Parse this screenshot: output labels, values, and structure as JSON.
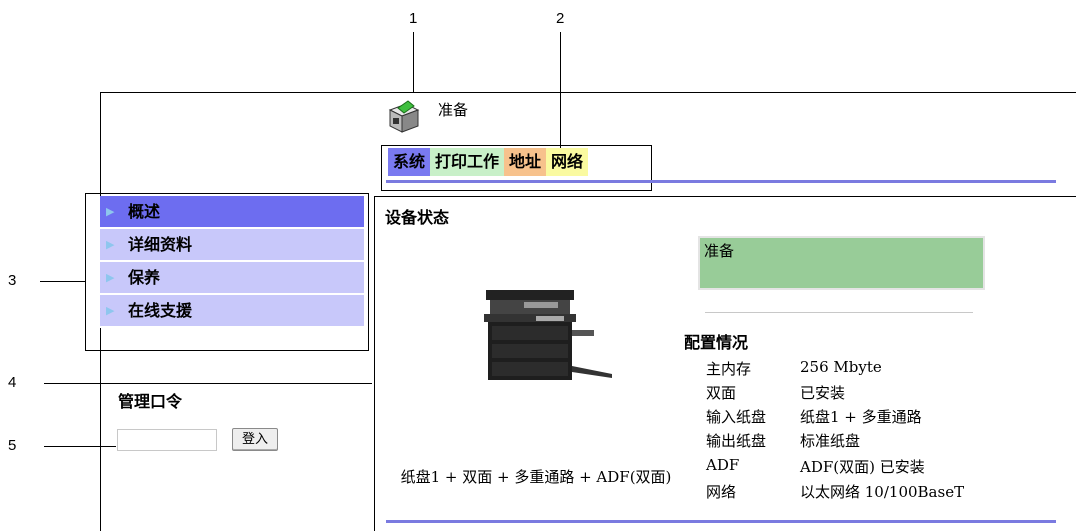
{
  "callouts": {
    "c1": "1",
    "c2": "2",
    "c3": "3",
    "c4": "4",
    "c5": "5"
  },
  "header": {
    "status_text": "准备"
  },
  "tabs": [
    {
      "label": "系统"
    },
    {
      "label": "打印工作"
    },
    {
      "label": "地址"
    },
    {
      "label": "网络"
    }
  ],
  "sidebar": {
    "items": [
      {
        "label": "概述",
        "active": true
      },
      {
        "label": "详细资料"
      },
      {
        "label": "保养"
      },
      {
        "label": "在线支援"
      }
    ],
    "admin": {
      "title": "管理口令",
      "password_value": "",
      "login_label": "登入"
    }
  },
  "main": {
    "heading": "设备状态",
    "status_box_text": "准备",
    "paper_config": "纸盘1 + 双面 + 多重通路 + ADF(双面)",
    "config": {
      "title": "配置情况",
      "rows": [
        {
          "key": "主内存",
          "value": "256 Mbyte"
        },
        {
          "key": "双面",
          "value": "已安装"
        },
        {
          "key": "输入纸盘",
          "value": "纸盘1 + 多重通路"
        },
        {
          "key": "输出纸盘",
          "value": "标准纸盘"
        },
        {
          "key": "ADF",
          "value": "ADF(双面) 已安装"
        },
        {
          "key": "网络",
          "value": "以太网络 10/100BaseT"
        }
      ]
    }
  },
  "colors": {
    "tab_system": "#7a7af0",
    "tab_print": "#c8f0c8",
    "tab_address": "#f7c28c",
    "tab_network": "#fafaa0",
    "menu_active": "#6d6df0",
    "menu_item": "#c8c8fa",
    "status_box": "#98cc98",
    "rule": "#7a7ae0"
  }
}
